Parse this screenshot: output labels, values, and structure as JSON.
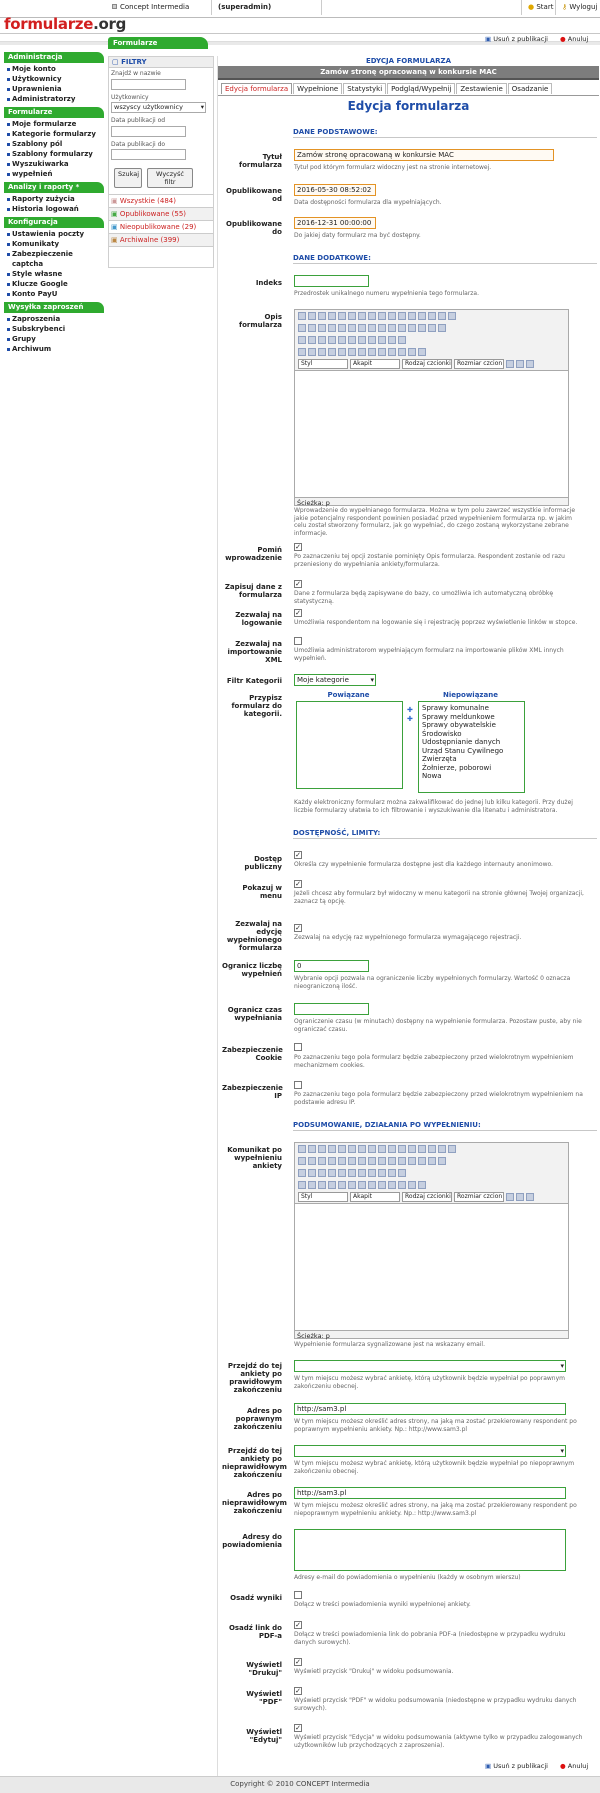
{
  "header": {
    "logo_main": "formularze",
    "logo_suffix": ".org",
    "company": "Concept Intermedia",
    "user": "(superadmin)",
    "start": "Start",
    "logout": "Wyloguj"
  },
  "section_tab": "Formularze",
  "top_actions": {
    "delete": "Usuń z publikacji",
    "cancel": "Anuluj"
  },
  "sidebar": {
    "groups": [
      {
        "title": "Administracja",
        "items": [
          "Moje konto",
          "Użytkownicy",
          "Uprawnienia",
          "Administratorzy"
        ]
      },
      {
        "title": "Formularze",
        "items": [
          "Moje formularze",
          "Kategorie formularzy",
          "Szablony pól",
          "Szablony formularzy",
          "Wyszukiwarka",
          "wypełnień"
        ]
      },
      {
        "title": "Analizy i raporty *",
        "items": [
          "Raporty zużycia",
          "Historia logowań"
        ]
      },
      {
        "title": "Konfiguracja",
        "items": [
          "Ustawienia poczty",
          "Komunikaty",
          "Zabezpieczenie captcha",
          "Style własne",
          "Klucze Google",
          "Konto PayU"
        ]
      },
      {
        "title": "Wysyłka zaproszeń",
        "items": [
          "Zaproszenia",
          "Subskrybenci",
          "Grupy",
          "Archiwum"
        ]
      }
    ]
  },
  "filters": {
    "title": "FILTRY",
    "name_label": "Znajdź w nazwie",
    "users_label": "Użytkownicy",
    "users_value": "wszyscy użytkownicy",
    "date_from": "Data publikacji od",
    "date_to": "Data publikacji do",
    "search": "Szukaj",
    "clear": "Wyczyść filtr",
    "counts": [
      "Wszystkie (484)",
      "Opublikowane (55)",
      "Nieopublikowane (29)",
      "Archiwalne (399)"
    ]
  },
  "main": {
    "title": "EDYCJA FORMULARZA",
    "subtitle": "Zamów stronę opracowaną w konkursie MAC",
    "tabs": [
      "Edycja formularza",
      "Wypełnione",
      "Statystyki",
      "Podgląd/Wypełnij",
      "Zestawienie",
      "Osadzanie"
    ],
    "heading": "Edycja formularza",
    "sec_basic": "DANE PODSTAWOWE:",
    "title_label": "Tytuł formularza",
    "title_value": "Zamów stronę opracowaną w konkursie MAC",
    "title_help": "Tytuł pod którym formularz widoczny jest na stronie internetowej.",
    "pub_from_label": "Opublikowane od",
    "pub_from_value": "2016-05-30 08:52:02",
    "pub_from_help": "Data dostępności formularza dla wypełniających.",
    "pub_to_label": "Opublikowane do",
    "pub_to_value": "2016-12-31 00:00:00",
    "pub_to_help": "Do jakiej daty formularz ma być dostępny.",
    "sec_extra": "DANE DODATKOWE:",
    "index_label": "Indeks",
    "index_help": "Przedrostek unikalnego numeru wypełnienia tego formularza.",
    "desc_label": "Opis formularza",
    "editor": {
      "style": "Styl",
      "format": "Akapit",
      "font": "Rodzaj czcionki",
      "size": "Rozmiar czcion",
      "path": "Ścieżka: p"
    },
    "desc_help": "Wprowadzenie do wypełnianego formularza. Można w tym polu zawrzeć wszystkie informacje jakie potencjalny respondent powinien posiadać przed wypełnieniem formularza np. w jakim celu został stworzony formularz, jak go wypełniać, do czego zostaną wykorzystane zebrane informacje.",
    "skip_label": "Pomiń wprowadzenie",
    "skip_help": "Po zaznaczeniu tej opcji zostanie pominięty Opis formularza. Respondent zostanie od razu przeniesiony do wypełniania ankiety/formularza.",
    "save_label": "Zapisuj dane z formularza",
    "save_help": "Dane z formularza będą zapisywane do bazy, co umożliwia ich automatyczną obróbkę statystyczną.",
    "login_label": "Zezwalaj na logowanie",
    "login_help": "Umożliwia respondentom na logowanie się i rejestrację poprzez wyświetlenie linków w stopce.",
    "xml_label": "Zezwalaj na importowanie XML",
    "xml_help": "Umożliwia administratorom wypełniającym formularz na importowanie plików XML innych wypełnień.",
    "cat_filter_label": "Filtr Kategorii",
    "cat_filter_value": "Moje kategorie",
    "assign_label": "Przypisz formularz do kategorii.",
    "linked_label": "Powiązane",
    "unlinked_label": "Niepowiązane",
    "unlinked_items": [
      "Sprawy komunalne",
      "Sprawy meldunkowe",
      "Sprawy obywatelskie",
      "Środowisko",
      "Udostępnianie danych",
      "Urząd Stanu Cywilnego",
      "Zwierzęta",
      "Żołnierze, poborowi",
      "Nowa"
    ],
    "assign_help": "Każdy elektroniczny formularz można zakwalifikować do jednej lub kilku kategorii. Przy dużej liczbie formularzy ułatwia to ich filtrowanie i wyszukiwanie dla litenatu i administratora.",
    "sec_access": "DOSTĘPNOŚĆ, LIMITY:",
    "public_label": "Dostęp publiczny",
    "public_help": "Określa czy wypełnienie formularza dostępne jest dla każdego internauty anonimowo.",
    "menu_label": "Pokazuj w menu",
    "menu_help": "Jeżeli chcesz aby formularz był widoczny w menu kategorii na stronie głównej Twojej organizacji, zaznacz tą opcję.",
    "edit_label": "Zezwalaj na edycję wypełnionego formularza",
    "edit_help": "Zezwalaj na edycję raz wypełnionego formularza wymagającego rejestracji.",
    "limit_label": "Ogranicz liczbę wypełnień",
    "limit_value": "0",
    "limit_help": "Wybranie opcji pozwala na ograniczenie liczby wypełnionych formularzy. Wartość 0 oznacza nieograniczoną ilość.",
    "time_label": "Ogranicz czas wypełniania",
    "time_help": "Ograniczenie czasu (w minutach) dostępny na wypełnienie formularza. Pozostaw puste, aby nie ograniczać czasu.",
    "cookie_label": "Zabezpieczenie Cookie",
    "cookie_help": "Po zaznaczeniu tego pola formularz będzie zabezpieczony przed wielokrotnym wypełnieniem mechanizmem cookies.",
    "ip_label": "Zabezpieczenie IP",
    "ip_help": "Po zaznaczeniu tego pola formularz będzie zabezpieczony przed wielokrotnym wypełnieniem na podstawie adresu IP.",
    "sec_summary": "PODSUMOWANIE, DZIAŁANIA PO WYPEŁNIENIU:",
    "msg_label": "Komunikat po wypełnieniu ankiety",
    "msg_help": "Wypełnienie formularza sygnalizowane jest na wskazany email.",
    "go_ok_label": "Przejdź do tej ankiety po prawidłowym zakończeniu",
    "go_ok_help": "W tym miejscu możesz wybrać ankietę, którą użytkownik będzie wypełniał po poprawnym zakończeniu obecnej.",
    "addr_ok_label": "Adres po poprawnym zakończeniu",
    "addr_ok_value": "http://sam3.pl",
    "addr_ok_help": "W tym miejscu możesz określić adres strony, na jaką ma zostać przekierowany respondent po poprawnym wypełnieniu ankiety. Np.: http://www.sam3.pl",
    "go_bad_label": "Przejdź do tej ankiety po nieprawidłowym zakończeniu",
    "go_bad_help": "W tym miejscu możesz wybrać ankietę, którą użytkownik będzie wypełniał po niepoprawnym zakończeniu obecnej.",
    "addr_bad_label": "Adres po nieprawidłowym zakończeniu",
    "addr_bad_value": "http://sam3.pl",
    "addr_bad_help": "W tym miejscu możesz określić adres strony, na jaką ma zostać przekierowany respondent po niepoprawnym wypełnieniu ankiety. Np.: http://www.sam3.pl",
    "notify_label": "Adresy do powiadomienia",
    "notify_help": "Adresy e-mail do powiadomienia o wypełnieniu (każdy w osobnym wierszu)",
    "attach_label": "Osadź wyniki",
    "attach_help": "Dołącz w treści powiadomienia wyniki wypełnionej ankiety.",
    "pdf_link_label": "Osadź link do PDF-a",
    "pdf_link_help": "Dołącz w treści powiadomienia link do pobrania PDF-a (niedostępne w przypadku wydruku danych surowych).",
    "print_label": "Wyświetl \"Drukuj\"",
    "print_help": "Wyświetl przycisk \"Drukuj\" w widoku podsumowania.",
    "pdf_label": "Wyświetl \"PDF\"",
    "pdf_help": "Wyświetl przycisk \"PDF\" w widoku podsumowania (niedostępne w przypadku wydruku danych surowych).",
    "editbtn_label": "Wyświetl \"Edytuj\"",
    "editbtn_help": "Wyświetl przycisk \"Edycja\" w widoku podsumowania (aktywne tylko w przypadku zalogowanych użytkowników lub przychodzących z zaproszenia)."
  },
  "footer": "Copyright © 2010 CONCEPT Intermedia"
}
